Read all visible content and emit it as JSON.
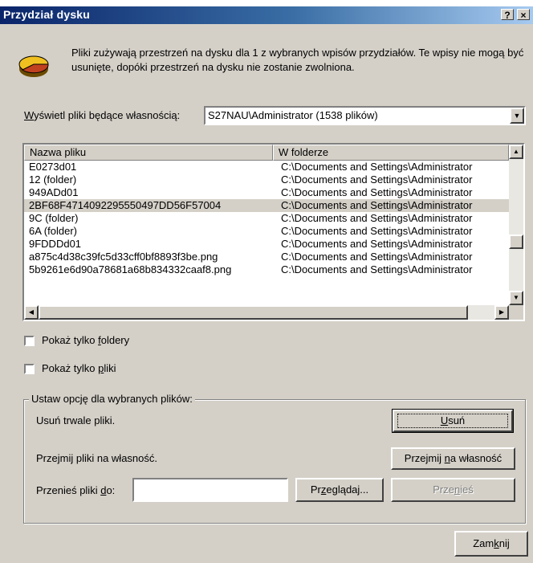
{
  "window": {
    "title": "Przydział dysku",
    "help_label": "?",
    "close_label": "×"
  },
  "info": {
    "text": "Pliki zużywają przestrzeń na dysku dla 1 z wybranych wpisów przydziałów. Te wpisy nie mogą być usunięte, dopóki przestrzeń na dysku nie zostanie zwolniona."
  },
  "owner": {
    "label_pre": "",
    "label_accel": "W",
    "label_post": "yświetl pliki będące własnością:",
    "selected": "S27NAU\\Administrator (1538 plików)"
  },
  "list": {
    "columns": [
      "Nazwa pliku",
      "W folderze"
    ],
    "rows": [
      {
        "name": "E0273d01",
        "folder": "C:\\Documents and Settings\\Administrator"
      },
      {
        "name": "12 (folder)",
        "folder": "C:\\Documents and Settings\\Administrator"
      },
      {
        "name": "949ADd01",
        "folder": "C:\\Documents and Settings\\Administrator"
      },
      {
        "name": "2BF68F4714092295550497DD56F57004",
        "folder": "C:\\Documents and Settings\\Administrator",
        "selected": true
      },
      {
        "name": "9C (folder)",
        "folder": "C:\\Documents and Settings\\Administrator"
      },
      {
        "name": "6A (folder)",
        "folder": "C:\\Documents and Settings\\Administrator"
      },
      {
        "name": "9FDDDd01",
        "folder": "C:\\Documents and Settings\\Administrator"
      },
      {
        "name": "a875c4d38c39fc5d33cff0bf8893f3be.png",
        "folder": "C:\\Documents and Settings\\Administrator"
      },
      {
        "name": "5b9261e6d90a78681a68b834332caaf8.png",
        "folder": "C:\\Documents and Settings\\Administrator"
      }
    ]
  },
  "filters": {
    "folders_pre": "Pokaż tylko ",
    "folders_accel": "f",
    "folders_post": "oldery",
    "files_pre": "Pokaż tylko ",
    "files_accel": "p",
    "files_post": "liki"
  },
  "group": {
    "title": "Ustaw opcję dla wybranych plików:",
    "delete_label": "Usuń trwale pliki.",
    "delete_button_accel": "U",
    "delete_button_post": "suń",
    "take_label": "Przejmij pliki na własność.",
    "take_button_pre": "Przejmij ",
    "take_button_accel": "n",
    "take_button_post": "a własność",
    "move_label_pre": "Przenieś pliki ",
    "move_label_accel": "d",
    "move_label_post": "o:",
    "move_value": "",
    "browse_pre": "Pr",
    "browse_accel": "z",
    "browse_post": "eglądaj...",
    "move_button_pre": "Prze",
    "move_button_accel": "n",
    "move_button_post": "ieś"
  },
  "footer": {
    "close_pre": "Zam",
    "close_accel": "k",
    "close_post": "nij"
  }
}
